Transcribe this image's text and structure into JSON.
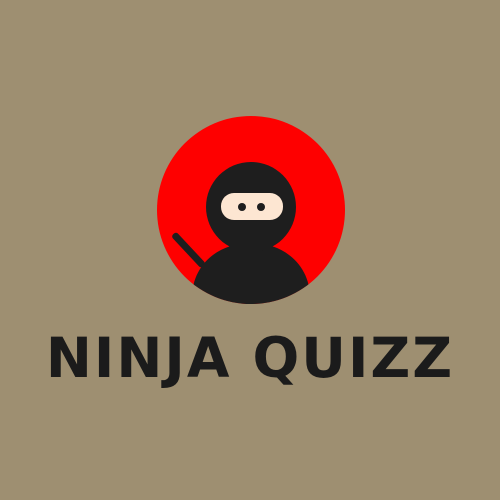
{
  "app": {
    "title": "NINJA QUIZZ"
  },
  "logo": {
    "icon": "ninja-icon"
  },
  "colors": {
    "background": "#9e8f71",
    "accent": "#fe0000",
    "ninja": "#1e1e1e",
    "skin": "#fde6d2",
    "title": "#1b1b1b"
  }
}
